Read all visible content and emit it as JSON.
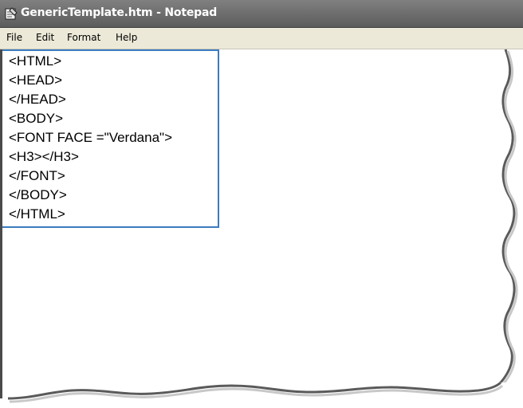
{
  "window": {
    "title": "GenericTemplate.htm - Notepad"
  },
  "menu": {
    "items": [
      "File",
      "Edit",
      "Format",
      "Help"
    ]
  },
  "editor": {
    "lines": [
      "<HTML>",
      "<HEAD>",
      "</HEAD>",
      "<BODY>",
      "<FONT FACE =\"Verdana\">",
      "<H3></H3>",
      "</FONT>",
      "</BODY>",
      "</HTML>"
    ]
  },
  "colors": {
    "titlebar": "#6a6a6a",
    "menubar": "#ece9d8",
    "selection_border": "#3b7bbf"
  },
  "icons": {
    "app": "notepad-icon"
  }
}
